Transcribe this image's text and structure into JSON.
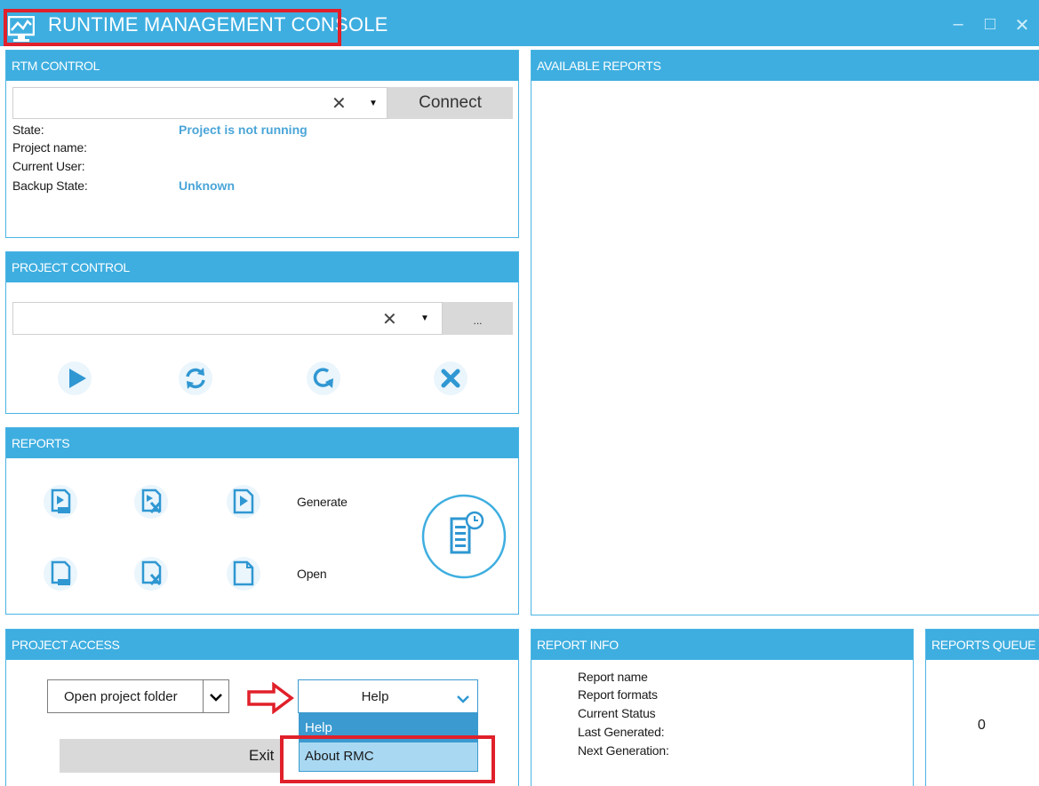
{
  "window": {
    "title": "RUNTIME MANAGEMENT CONSOLE",
    "minimize_glyph": "–",
    "maximize_glyph": "□",
    "close_glyph": "✕"
  },
  "rtm_control": {
    "header": "RTM CONTROL",
    "server_value": "",
    "clear_glyph": "✕",
    "caret_glyph": "▼",
    "connect_label": "Connect",
    "state_label": "State:",
    "state_value": "Project is not running",
    "project_name_label": "Project name:",
    "project_name_value": "",
    "current_user_label": "Current User:",
    "current_user_value": "",
    "backup_state_label": "Backup State:",
    "backup_state_value": "Unknown"
  },
  "project_control": {
    "header": "PROJECT CONTROL",
    "project_value": "",
    "clear_glyph": "✕",
    "caret_glyph": "▼",
    "browse_label": "...",
    "icons": [
      "play-icon",
      "restart-icon",
      "reload-icon",
      "stop-icon"
    ]
  },
  "reports": {
    "header": "REPORTS",
    "generate_label": "Generate",
    "open_label": "Open",
    "icons": [
      "generate-pdf-icon",
      "generate-excel-icon",
      "generate-document-icon",
      "open-pdf-icon",
      "open-excel-icon",
      "open-document-icon",
      "schedule-report-icon"
    ]
  },
  "available_reports": {
    "header": "AVAILABLE REPORTS"
  },
  "project_access": {
    "header": "PROJECT ACCESS",
    "open_folder_label": "Open project folder",
    "open_folder_caret": "❱",
    "help_select_value": "Help",
    "help_caret": "⌄",
    "dropdown_options": [
      "Help",
      "About RMC"
    ],
    "exit_label": "Exit"
  },
  "report_info": {
    "header": "REPORT INFO",
    "report_name_label": "Report name",
    "report_formats_label": "Report formats",
    "current_status_label": "Current Status",
    "last_generated_label": "Last Generated:",
    "next_generation_label": "Next Generation:"
  },
  "reports_queue": {
    "header": "REPORTS QUEUE",
    "count": "0"
  },
  "colors": {
    "accent": "#3eaee0",
    "highlight": "#e0202a",
    "value_blue": "#4aa5d8",
    "dropdown_selected": "#3b9ad0",
    "dropdown_hover": "#a9d8f2"
  }
}
